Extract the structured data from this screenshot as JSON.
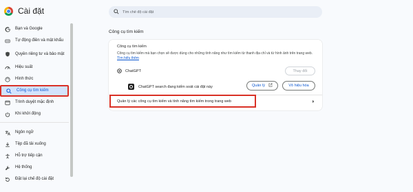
{
  "header": {
    "app_title": "Cài đặt",
    "search_placeholder": "Tìm chế độ cài đặt"
  },
  "sidebar": {
    "items": [
      {
        "label": "Bạn và Google",
        "icon": "google-icon"
      },
      {
        "label": "Tự động điền và mật khẩu",
        "icon": "autofill-icon"
      },
      {
        "label": "Quyền riêng tư và bảo mật",
        "icon": "shield-icon"
      },
      {
        "label": "Hiệu suất",
        "icon": "speedometer-icon"
      },
      {
        "label": "Hình thức",
        "icon": "palette-icon"
      },
      {
        "label": "Công cụ tìm kiếm",
        "icon": "search-icon",
        "active": true
      },
      {
        "label": "Trình duyệt mặc định",
        "icon": "browser-icon"
      },
      {
        "label": "Khi khởi động",
        "icon": "power-icon"
      },
      {
        "label": "Ngôn ngữ",
        "icon": "translate-icon"
      },
      {
        "label": "Tệp đã tải xuống",
        "icon": "download-icon"
      },
      {
        "label": "Hỗ trợ tiếp cận",
        "icon": "accessibility-icon"
      },
      {
        "label": "Hệ thống",
        "icon": "wrench-icon"
      },
      {
        "label": "Đặt lại chế độ cài đặt",
        "icon": "reset-icon"
      }
    ]
  },
  "main": {
    "section_title": "Công cụ tìm kiếm",
    "card": {
      "title": "Công cụ tìm kiếm",
      "description": "Công cụ tìm kiếm mà bạn chọn sẽ được dùng cho những tính năng như tìm kiếm từ thanh địa chỉ và từ hình ảnh trên trang web.",
      "learn_more": "Tìm hiểu thêm",
      "engine_name": "ChatGPT",
      "change_button": "Thay đổi",
      "extension_text": "ChatGPT search đang kiểm soát cài đặt này",
      "manage_button": "Quản lý",
      "disable_button": "Vô hiệu hóa",
      "manage_engines_label": "Quản lý các công cụ tìm kiếm và tính năng tìm kiếm trong trang web"
    }
  },
  "colors": {
    "accent": "#0b57d0",
    "active_bg": "#d3e3fd",
    "highlight_red": "#d93025",
    "page_bg": "#f8fafd"
  }
}
